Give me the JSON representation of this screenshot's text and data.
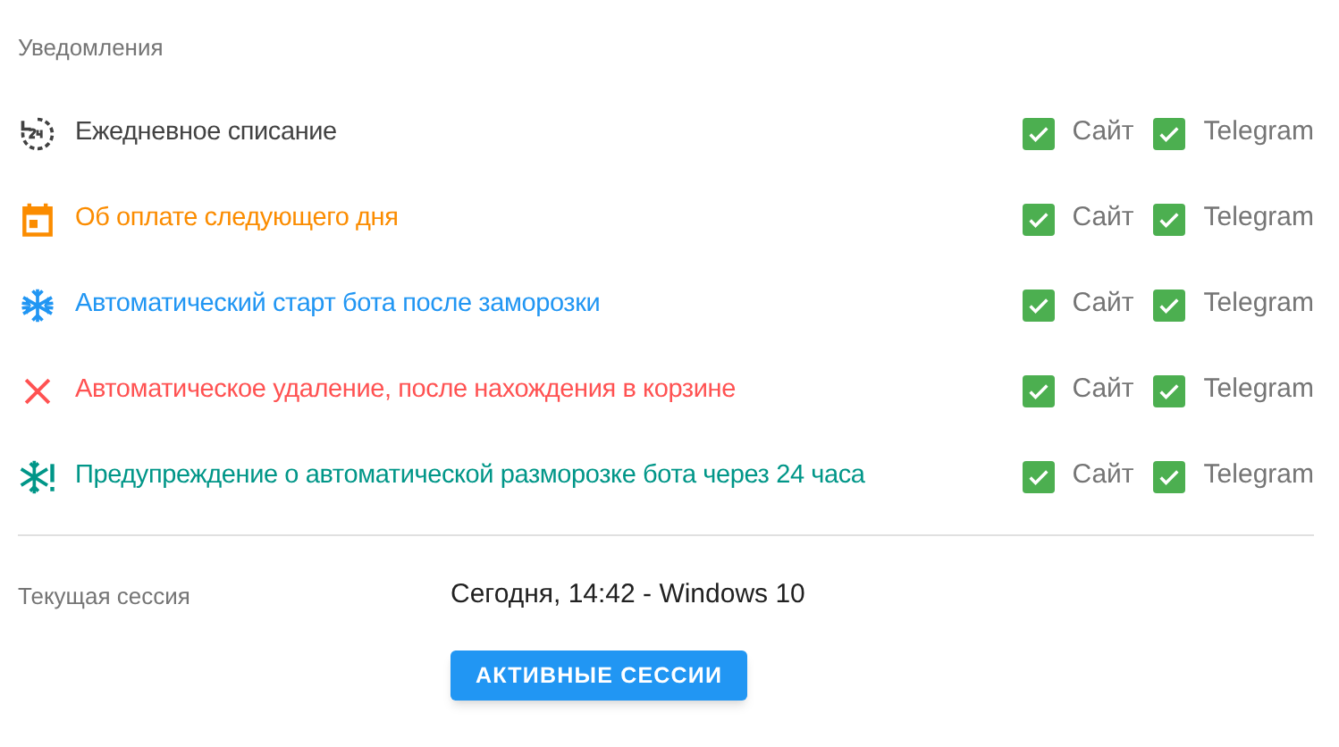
{
  "notifications": {
    "title": "Уведомления",
    "items": [
      {
        "kind": "daily",
        "label": "Ежедневное списание",
        "color": "#424242",
        "site": {
          "label": "Сайт",
          "checked": true
        },
        "telegram": {
          "label": "Telegram",
          "checked": true
        }
      },
      {
        "kind": "calendar",
        "label": "Об оплате следующего дня",
        "color": "#fb8c00",
        "site": {
          "label": "Сайт",
          "checked": true
        },
        "telegram": {
          "label": "Telegram",
          "checked": true
        }
      },
      {
        "kind": "freeze",
        "label": "Автоматический старт бота после заморозки",
        "color": "#2196f3",
        "site": {
          "label": "Сайт",
          "checked": true
        },
        "telegram": {
          "label": "Telegram",
          "checked": true
        }
      },
      {
        "kind": "delete",
        "label": "Автоматическое удаление, после нахождения в корзине",
        "color": "#ff5252",
        "site": {
          "label": "Сайт",
          "checked": true
        },
        "telegram": {
          "label": "Telegram",
          "checked": true
        }
      },
      {
        "kind": "unfreeze",
        "label": "Предупреждение о автоматической разморозке бота через 24 часа",
        "color": "#009688",
        "site": {
          "label": "Сайт",
          "checked": true
        },
        "telegram": {
          "label": "Telegram",
          "checked": true
        }
      }
    ]
  },
  "session": {
    "label": "Текущая сессия",
    "value": "Сегодня, 14:42 - Windows 10",
    "button": "АКТИВНЫЕ СЕССИИ"
  }
}
